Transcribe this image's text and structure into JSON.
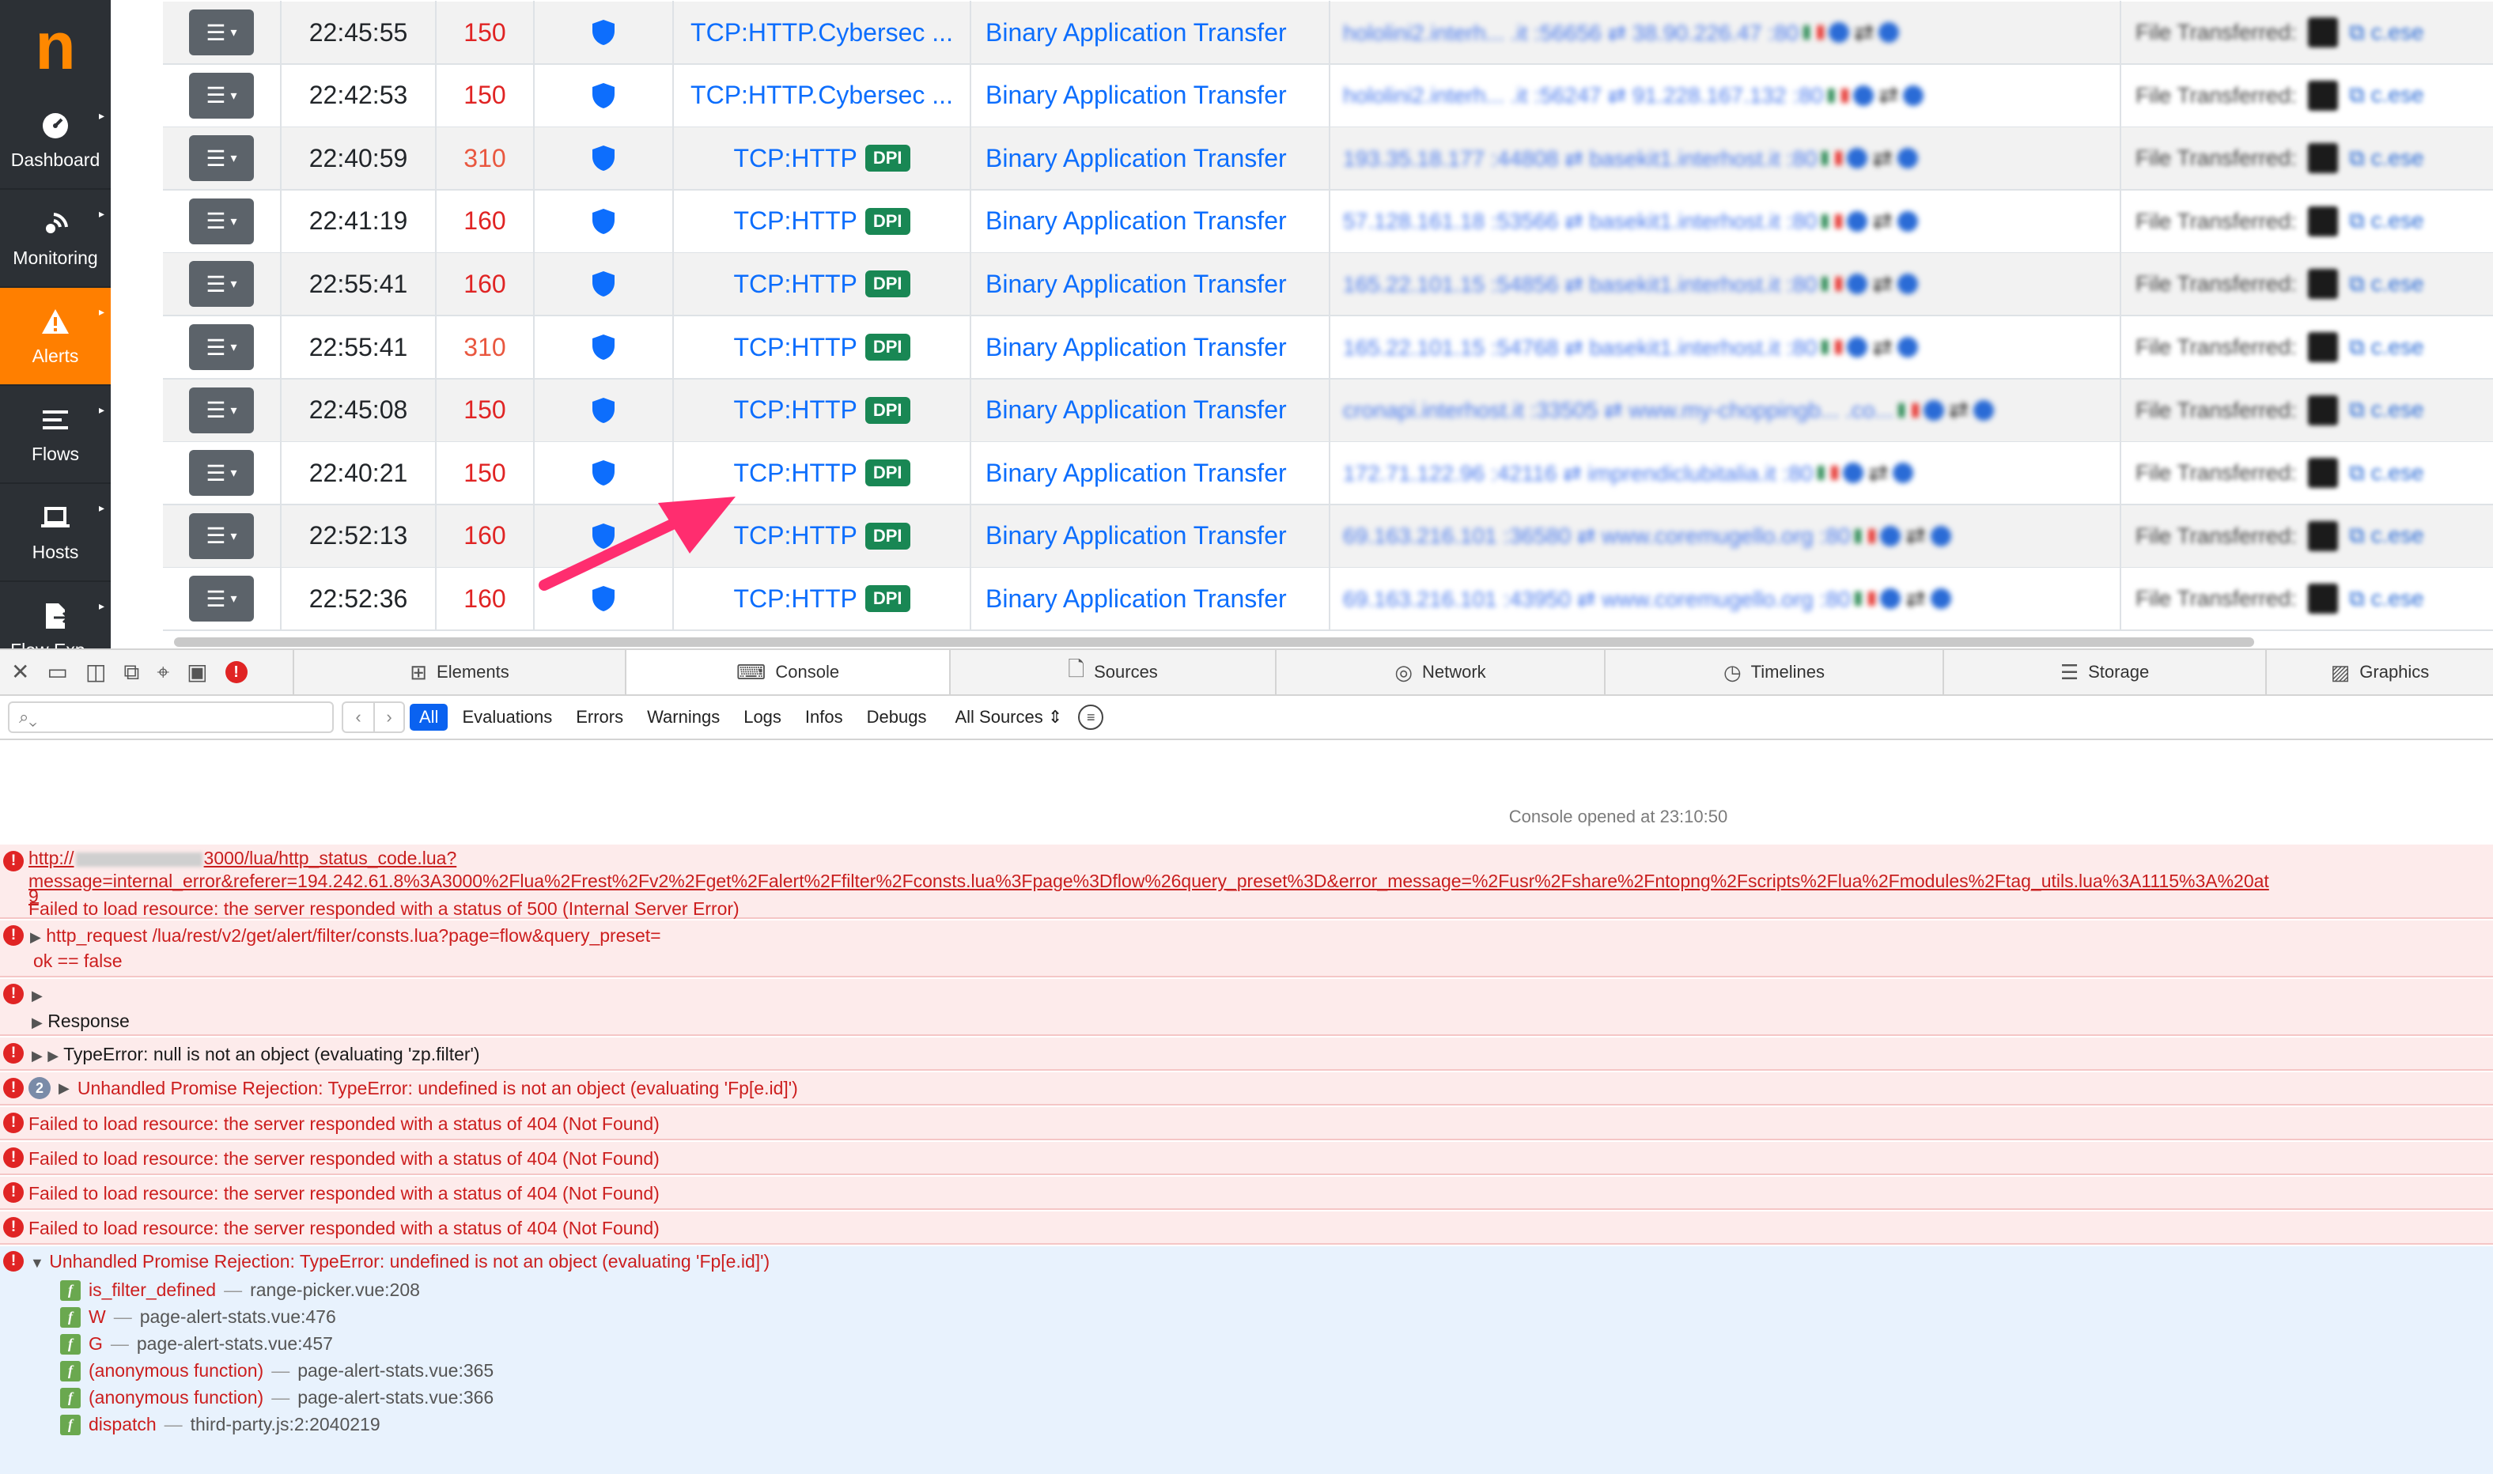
{
  "sidebar": {
    "logo": "n",
    "items": [
      {
        "label": "Dashboard",
        "icon": "gauge-icon",
        "active": false
      },
      {
        "label": "Monitoring",
        "icon": "monitoring-icon",
        "active": false
      },
      {
        "label": "Alerts",
        "icon": "warning-icon",
        "active": true
      },
      {
        "label": "Flows",
        "icon": "flows-icon",
        "active": false
      },
      {
        "label": "Hosts",
        "icon": "laptop-icon",
        "active": false
      },
      {
        "label": "Flow Exp...",
        "icon": "file-export-icon",
        "active": false
      }
    ]
  },
  "alerts_table": {
    "rows": [
      {
        "time": "22:45:55",
        "score": "150",
        "score_level": "high",
        "app": "TCP:HTTP.Cybersec ...",
        "dpi": "",
        "alert": "Binary Application Transfer",
        "desc": "hololini2.interh... .it :56656 ⇄ 38.90.226.47 :80",
        "info": "File Transferred:"
      },
      {
        "time": "22:42:53",
        "score": "150",
        "score_level": "high",
        "app": "TCP:HTTP.Cybersec ...",
        "dpi": "",
        "alert": "Binary Application Transfer",
        "desc": "hololini2.interh... .it :56247 ⇄ 91.228.167.132 :80",
        "info": "File Transferred:"
      },
      {
        "time": "22:40:59",
        "score": "310",
        "score_level": "high",
        "app": "TCP:HTTP",
        "dpi": "DPI",
        "alert": "Binary Application Transfer",
        "desc": "193.35.18.177 :44808 ⇄ basekit1.interhost.it :80",
        "info": "File Transferred:"
      },
      {
        "time": "22:41:19",
        "score": "160",
        "score_level": "high",
        "app": "TCP:HTTP",
        "dpi": "DPI",
        "alert": "Binary Application Transfer",
        "desc": "57.128.161.18 :53566 ⇄ basekit1.interhost.it :80",
        "info": "File Transferred:"
      },
      {
        "time": "22:55:41",
        "score": "160",
        "score_level": "high",
        "app": "TCP:HTTP",
        "dpi": "DPI",
        "alert": "Binary Application Transfer",
        "desc": "165.22.101.15 :54856 ⇄ basekit1.interhost.it :80",
        "info": "File Transferred:"
      },
      {
        "time": "22:55:41",
        "score": "310",
        "score_level": "high",
        "app": "TCP:HTTP",
        "dpi": "DPI",
        "alert": "Binary Application Transfer",
        "desc": "165.22.101.15 :54768 ⇄ basekit1.interhost.it :80",
        "info": "File Transferred:"
      },
      {
        "time": "22:45:08",
        "score": "150",
        "score_level": "high",
        "app": "TCP:HTTP",
        "dpi": "DPI",
        "alert": "Binary Application Transfer",
        "desc": "cronapi.interhost.it :33505 ⇄ www.my-choppingb... .co...",
        "info": "File Transferred:"
      },
      {
        "time": "22:40:21",
        "score": "150",
        "score_level": "high",
        "app": "TCP:HTTP",
        "dpi": "DPI",
        "alert": "Binary Application Transfer",
        "desc": "172.71.122.96 :42116 ⇄ imprendiclubitalia.it :80",
        "info": "File Transferred:"
      },
      {
        "time": "22:52:13",
        "score": "160",
        "score_level": "high",
        "app": "TCP:HTTP",
        "dpi": "DPI",
        "alert": "Binary Application Transfer",
        "desc": "69.163.216.101 :36580 ⇄ www.coremugello.org :80",
        "info": "File Transferred:"
      },
      {
        "time": "22:52:36",
        "score": "160",
        "score_level": "high",
        "app": "TCP:HTTP",
        "dpi": "DPI",
        "alert": "Binary Application Transfer",
        "desc": "69.163.216.101 :43950 ⇄ www.coremugello.org :80",
        "info": "File Transferred:"
      }
    ]
  },
  "devtools": {
    "error_badge": "!",
    "tabs": [
      {
        "label": "Elements",
        "icon": "elements-icon",
        "active": false
      },
      {
        "label": "Console",
        "icon": "console-icon",
        "active": true
      },
      {
        "label": "Sources",
        "icon": "sources-icon",
        "active": false
      },
      {
        "label": "Network",
        "icon": "network-icon",
        "active": false
      },
      {
        "label": "Timelines",
        "icon": "timelines-icon",
        "active": false
      },
      {
        "label": "Storage",
        "icon": "storage-icon",
        "active": false
      },
      {
        "label": "Graphics",
        "icon": "graphics-icon",
        "active": false
      }
    ],
    "filters": [
      "All",
      "Evaluations",
      "Errors",
      "Warnings",
      "Logs",
      "Infos",
      "Debugs"
    ],
    "active_filter": "All",
    "sources": "All Sources",
    "console_opened": "Console opened at 23:10:50",
    "messages": {
      "m1_url_a": "http://",
      "m1_url_b": "3000/lua/http_status_code.lua?",
      "m1_url_c": "message=internal_error&referer=194.242.61.8%3A3000%2Flua%2Frest%2Fv2%2Fget%2Falert%2Ffilter%2Fconsts.lua%3Fpage%3Dflow%26query_preset%3D&error_message=%2Fusr%2Fshare%2Fntopng%2Fscripts%2Flua%2Fmodules%2Ftag_utils.lua%3A1115%3A%20at",
      "m1_url_d": "9",
      "m1_text": "Failed to load resource: the server responded with a status of 500 (Internal Server Error)",
      "m2_text": "http_request /lua/rest/v2/get/alert/filter/consts.lua?page=flow&query_preset=",
      "m2_sub": "ok == false",
      "m3_sub": "Response",
      "m4_text": "TypeError: null is not an object (evaluating 'zp.filter')",
      "m5_count": "2",
      "m5_text": "Unhandled Promise Rejection: TypeError: undefined is not an object (evaluating 'Fp[e.id]')",
      "m404": "Failed to load resource: the server responded with a status of 404 (Not Found)",
      "m10_text": "Unhandled Promise Rejection: TypeError: undefined is not an object (evaluating 'Fp[e.id]')"
    },
    "stack": [
      {
        "fn": "is_filter_defined",
        "loc": "range-picker.vue:208"
      },
      {
        "fn": "W",
        "loc": "page-alert-stats.vue:476"
      },
      {
        "fn": "G",
        "loc": "page-alert-stats.vue:457"
      },
      {
        "fn": "(anonymous function)",
        "loc": "page-alert-stats.vue:365"
      },
      {
        "fn": "(anonymous function)",
        "loc": "page-alert-stats.vue:366"
      },
      {
        "fn": "dispatch",
        "loc": "third-party.js:2:2040219"
      }
    ]
  }
}
